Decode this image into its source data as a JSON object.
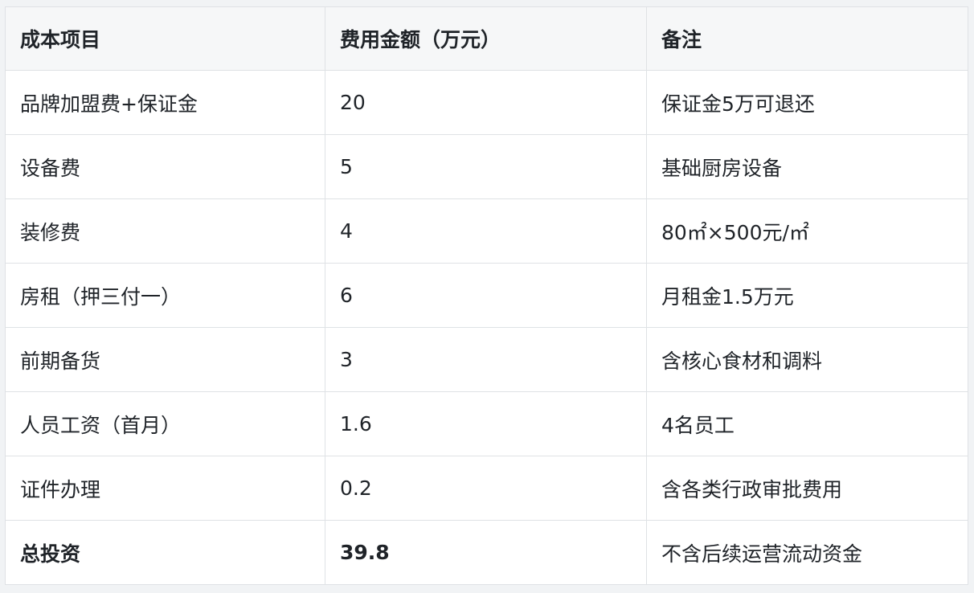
{
  "table": {
    "headers": [
      "成本项目",
      "费用金额（万元）",
      "备注"
    ],
    "rows": [
      {
        "item": "品牌加盟费+保证金",
        "amount": "20",
        "note": "保证金5万可退还"
      },
      {
        "item": "设备费",
        "amount": "5",
        "note": "基础厨房设备"
      },
      {
        "item": "装修费",
        "amount": "4",
        "note": "80㎡×500元/㎡"
      },
      {
        "item": "房租（押三付一）",
        "amount": "6",
        "note": "月租金1.5万元"
      },
      {
        "item": "前期备货",
        "amount": "3",
        "note": "含核心食材和调料"
      },
      {
        "item": "人员工资（首月）",
        "amount": "1.6",
        "note": "4名员工"
      },
      {
        "item": "证件办理",
        "amount": "0.2",
        "note": "含各类行政审批费用"
      }
    ],
    "total": {
      "item": "总投资",
      "amount": "39.8",
      "note": "不含后续运营流动资金"
    }
  }
}
